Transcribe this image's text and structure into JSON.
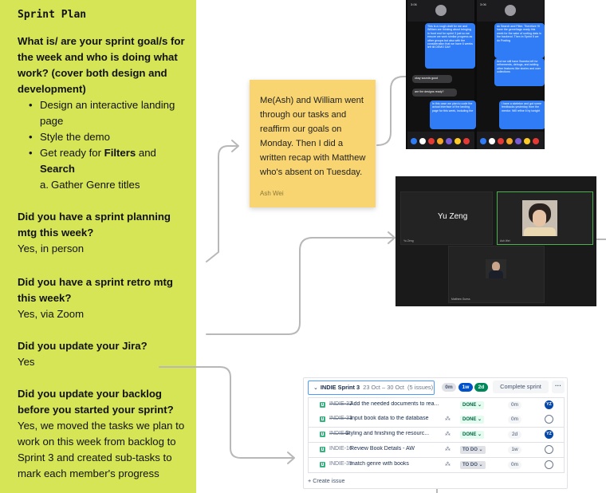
{
  "panel": {
    "title": "Sprint Plan",
    "q1": "What is/ are your sprint goal/s for the week and who is doing what work? (cover both design and development)",
    "goals": [
      "Design an interactive landing page",
      "Style the demo"
    ],
    "goal3_pre": "Get ready for ",
    "goal3_b1": "Filters",
    "goal3_mid": " and ",
    "goal3_b2": "Search",
    "subgoal": "Gather Genre titles",
    "q2": "Did you have a sprint planning mtg this week?",
    "a2": "Yes, in person",
    "q3": "Did you have a sprint retro mtg this week?",
    "a3": "Yes, via Zoom",
    "q4": "Did you update your Jira?",
    "a4": "Yes",
    "q5": "Did you update your backlog before you started your sprint?",
    "a5": "Yes, we moved the tasks we plan to work on this week from backlog to Sprint 3 and created sub-tasks to mark each member's progress"
  },
  "sticky": {
    "text": "Me(Ash) and William went through our tasks and reaffirm our goals on Monday. Then I did a written recap with Matthew who's absent on Tuesday.",
    "author": "Ash Wei"
  },
  "chat": {
    "time": "3:06",
    "left_bubbles": [
      "This is a rough draft for me and William are thinking about bringing in front end for sprint 3 just so we ensure we work similar progress as other groups but also with the consideration that we have 6 weeks left till DEMO DAY",
      "okay sounds good",
      "are the designs ready?",
      "In this case we plan to code the actual interface of the landing page for this week, including the"
    ],
    "right_bubbles": [
      "do Search and Filter. Therefore I'll have the genre/tags ready this week for the sake of sorting data in the backend. Then in Sprint 5 we do Posting",
      "And we still have Sweeks left for refinements, debugs, and adding other features like stories and user collections",
      "I have a skeleton and got some feedbacks yesterday from the mentor. Will refine it by tonight"
    ]
  },
  "zoom": {
    "participant1": "Yu Zeng",
    "label1": "Yu Zeng",
    "label2": "Ash Wei",
    "label3": "Matthew Guess"
  },
  "jira": {
    "sprint_name": "INDIE Sprint 3",
    "sprint_dates": "23 Oct – 30 Oct",
    "issue_count": "(5 issues)",
    "est_gray": "0m",
    "est_blue": "1w",
    "est_green": "2d",
    "complete_label": "Complete sprint",
    "more_label": "···",
    "create_label": "+ Create issue",
    "issues": [
      {
        "key": "INDIE-32",
        "summary": "Add the needed documents to rea...",
        "status": "DONE",
        "estimate": "0m",
        "assignee": "YZ",
        "done": true
      },
      {
        "key": "INDIE-33",
        "summary": "Input book data to the database",
        "status": "DONE",
        "estimate": "0m",
        "assignee": "",
        "done": true
      },
      {
        "key": "INDIE-3",
        "summary": "Styling and finishing the resourc...",
        "status": "DONE",
        "estimate": "2d",
        "assignee": "YZ",
        "done": true
      },
      {
        "key": "INDIE-16",
        "summary": "Review Book Details - AW",
        "status": "TO DO",
        "estimate": "1w",
        "assignee": "",
        "done": false
      },
      {
        "key": "INDIE-35",
        "summary": "match genre with books",
        "status": "TO DO",
        "estimate": "0m",
        "assignee": "",
        "done": false
      }
    ]
  },
  "colors": {
    "panel": "#d6e556",
    "sticky": "#f8d571",
    "connector": "#b8b8b8",
    "jira_blue": "#0052cc",
    "jira_green": "#00875a"
  }
}
